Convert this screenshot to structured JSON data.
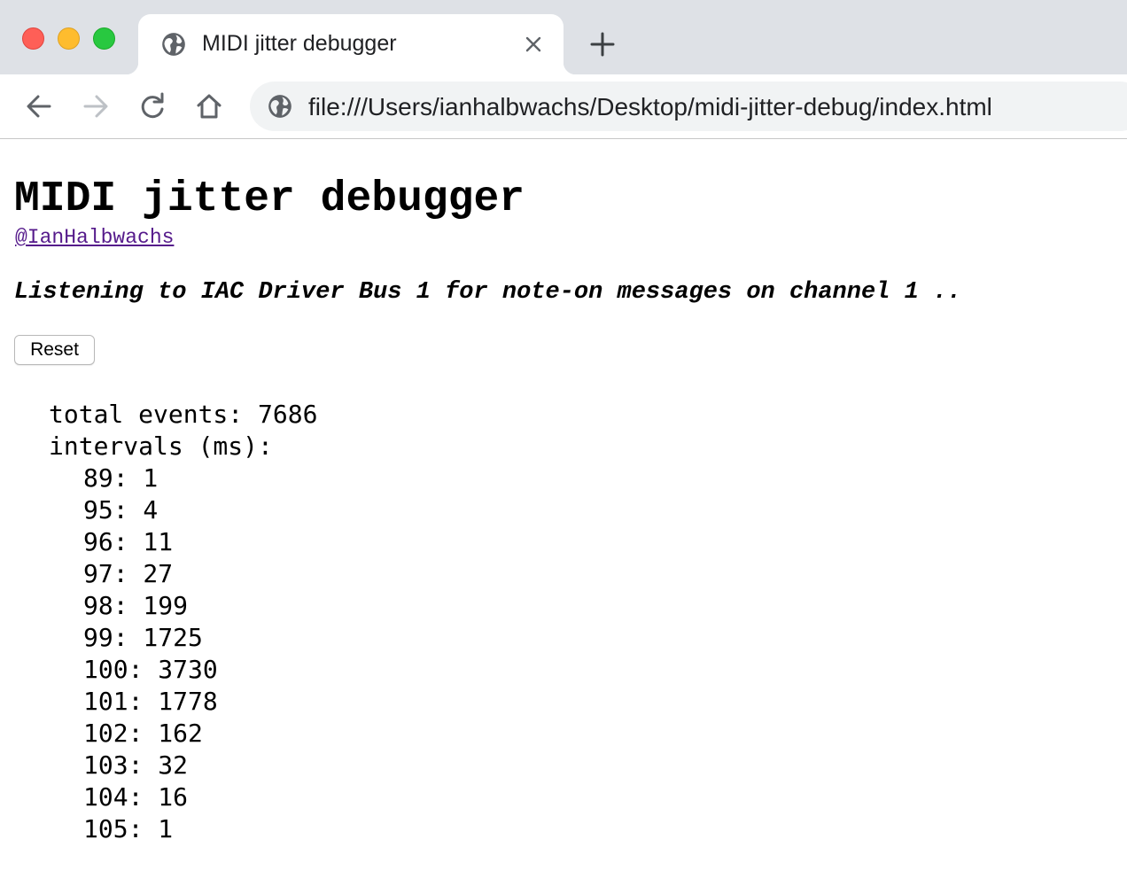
{
  "window": {
    "tab_title": "MIDI jitter debugger",
    "url": "file:///Users/ianhalbwachs/Desktop/midi-jitter-debug/index.html"
  },
  "page": {
    "title": "MIDI jitter debugger",
    "author_link": "@IanHalbwachs",
    "status": "Listening to IAC Driver Bus 1 for note-on messages on channel 1 ..",
    "reset_label": "Reset",
    "total_events_label": "total events: 7686",
    "intervals_label": "intervals (ms):",
    "intervals": [
      {
        "text": "89: 1"
      },
      {
        "text": "95: 4"
      },
      {
        "text": "96: 11"
      },
      {
        "text": "97: 27"
      },
      {
        "text": "98: 199"
      },
      {
        "text": "99: 1725"
      },
      {
        "text": "100: 3730"
      },
      {
        "text": "101: 1778"
      },
      {
        "text": "102: 162"
      },
      {
        "text": "103: 32"
      },
      {
        "text": "104: 16"
      },
      {
        "text": "105: 1"
      }
    ]
  },
  "colors": {
    "titlebar": "#dee1e6",
    "omnibox": "#f1f3f4",
    "link_visited": "#551a8b",
    "icon": "#5f6368"
  }
}
